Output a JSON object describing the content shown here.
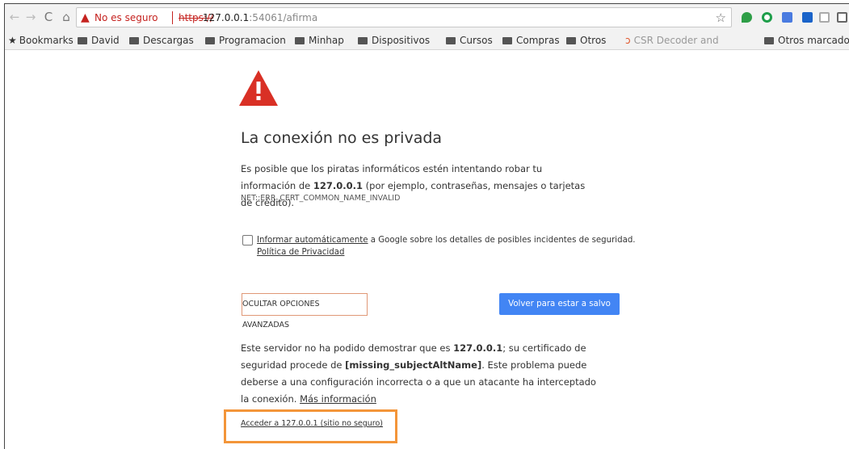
{
  "toolbar": {
    "security_label": "No es seguro",
    "url_scheme": "https://",
    "url_host": "127.0.0.1",
    "url_rest": ":54061/afirma"
  },
  "bookmarks": {
    "items": [
      "Bookmarks",
      "David",
      "Descargas",
      "Programacion",
      "Minhap",
      "Dispositivos",
      "Cursos",
      "Compras",
      "Otros",
      "CSR Decoder and"
    ],
    "other": "Otros marcadores"
  },
  "interstitial": {
    "title": "La conexión no es privada",
    "desc_part1": "Es posible que los piratas informáticos estén intentando robar tu información de ",
    "desc_host": "127.0.0.1",
    "desc_part2": " (por ejemplo, contraseñas, mensajes o tarjetas de crédito).",
    "error_code": "NET::ERR_CERT_COMMON_NAME_INVALID",
    "report_link": "Informar automáticamente",
    "report_text": " a Google sobre los detalles de posibles incidentes de seguridad.",
    "privacy_link": "Política de Privacidad",
    "advanced_button": "OCULTAR OPCIONES AVANZADAS",
    "safe_button": "Volver para estar a salvo",
    "details_part1": "Este servidor no ha podido demostrar que es ",
    "details_host": "127.0.0.1",
    "details_part2": "; su certificado de seguridad procede de ",
    "details_issuer": "[missing_subjectAltName]",
    "details_part3": ". Este problema puede deberse a una configuración incorrecta o a que un atacante ha interceptado la conexión. ",
    "more_info_link": "Más información",
    "proceed_link": "Acceder a 127.0.0.1 (sitio no seguro)"
  },
  "colors": {
    "danger": "#c5221f",
    "warning_icon": "#d93025",
    "primary_button": "#4285f4",
    "highlight_box": "#f39539"
  }
}
